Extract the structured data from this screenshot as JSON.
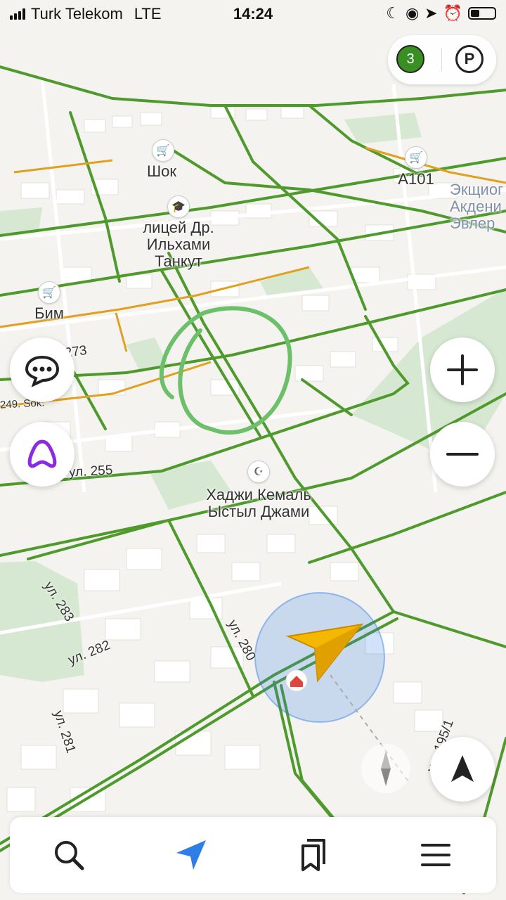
{
  "status": {
    "carrier": "Turk Telekom",
    "network": "LTE",
    "time": "14:24"
  },
  "topbar": {
    "traffic_level": "3",
    "parking_label": "P"
  },
  "places": {
    "shop1": "Шок",
    "school": "лицей Др. Ильхами Танкут",
    "shop2": "Бим",
    "shop3": "A101",
    "mosque": "Хаджи Кемаль Ыстыл Джами",
    "district": "Экщиог Акдени Эвлер"
  },
  "streets": {
    "s273": "273",
    "s249": "249. Sok.",
    "s255": "ул. 255",
    "s283": "ул. 283",
    "s282": "ул. 282",
    "s280": "ул. 280",
    "s281": "ул. 281",
    "s195": "ул. 195/1"
  },
  "colors": {
    "road_green": "#4f9a2c",
    "road_orange": "#e0a020",
    "annotation": "#6cc06a",
    "accent_blue": "#2f7de8",
    "alice_purple": "#8a2be2",
    "cursor_yellow": "#f5b800"
  },
  "icons": {
    "chat": "chat-icon",
    "alice": "alice-icon",
    "zoom_in": "plus-icon",
    "zoom_out": "minus-icon",
    "compass": "compass-icon",
    "locate": "locate-arrow-icon",
    "search": "search-icon",
    "navigate": "navigation-arrow-icon",
    "bookmarks": "bookmarks-icon",
    "menu": "menu-icon"
  }
}
